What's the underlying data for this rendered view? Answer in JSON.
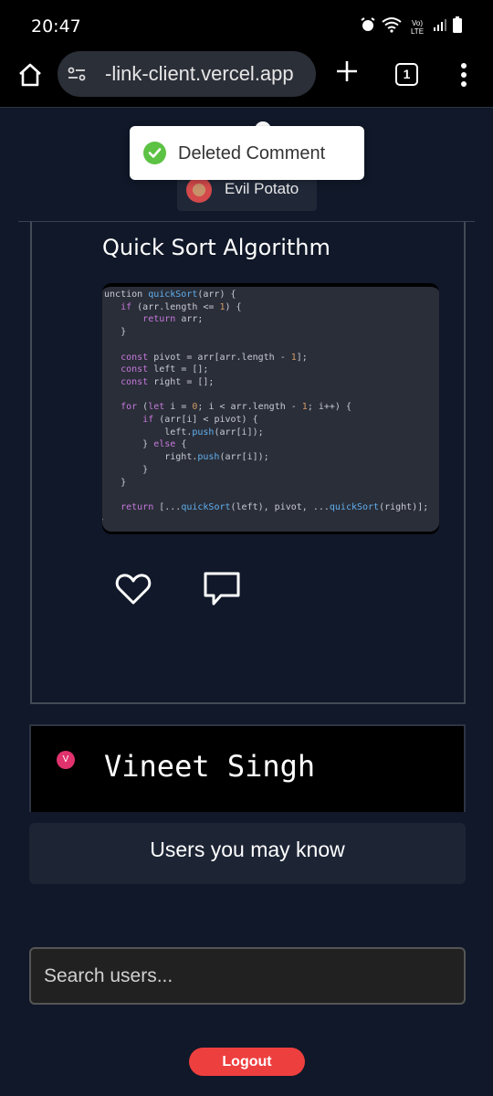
{
  "status_bar": {
    "time": "20:47",
    "network_label": "Vo) LTE"
  },
  "browser": {
    "url": "-link-client.vercel.app",
    "tab_count": "1"
  },
  "toast": {
    "message": "Deleted Comment"
  },
  "post": {
    "author": "Evil Potato",
    "title": "Quick Sort Algorithm",
    "code_lines": [
      ".unction quickSort(arr) {",
      "    if (arr.length <= 1) {",
      "        return arr;",
      "    }",
      "",
      "    const pivot = arr[arr.length - 1];",
      "    const left = [];",
      "    const right = [];",
      "",
      "    for (let i = 0; i < arr.length - 1; i++) {",
      "        if (arr[i] < pivot) {",
      "            left.push(arr[i]);",
      "        } else {",
      "            right.push(arr[i]);",
      "        }",
      "    }",
      "",
      "    return [...quickSort(left), pivot, ...quickSort(right)];",
      "}"
    ]
  },
  "profile": {
    "initial": "V",
    "name": "Vineet Singh"
  },
  "suggestions": {
    "title": "Users you may know"
  },
  "search": {
    "placeholder": "Search users..."
  },
  "logout": {
    "label": "Logout"
  },
  "colors": {
    "accent_red": "#ee3f3f",
    "success_green": "#5cc243",
    "badge_pink": "#e0336d",
    "page_bg": "#101829"
  }
}
